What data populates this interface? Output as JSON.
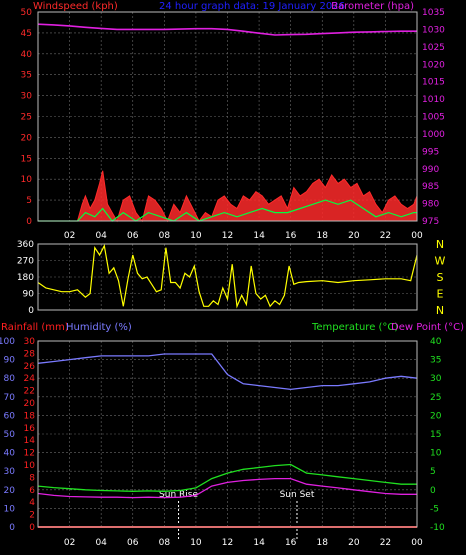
{
  "header": {
    "left_title": "Windspeed (kph)",
    "center_title": "24 hour graph data: 19 January 2026",
    "right_title": "Barometer (hpa)"
  },
  "colors": {
    "background": "#000000",
    "grid": "#6a6a6a",
    "windspeed": "#ff2a2a",
    "gust": "#ff2a2a",
    "wind_avg": "#00ff40",
    "wind_min": "#ffffff",
    "barometer": "#e020e0",
    "direction": "#ffff00",
    "rainfall": "#ff2020",
    "humidity": "#7a7aff",
    "temperature": "#20e020",
    "dewpoint": "#e020e0",
    "title_blue": "#2020ff",
    "sun_marker": "#ffffff"
  },
  "chart_data": [
    {
      "id": "wind_pressure",
      "type": "line",
      "title": "24 hour graph data: 19 January 2026",
      "ylabel_left": "Windspeed (kph)",
      "ylabel_right": "Barometer (hpa)",
      "ylim_left": [
        0,
        50
      ],
      "ylim_right": [
        975,
        1035
      ],
      "yticks_left": [
        0,
        5,
        10,
        15,
        20,
        25,
        30,
        35,
        40,
        45,
        50
      ],
      "yticks_right": [
        975,
        980,
        985,
        990,
        995,
        1000,
        1005,
        1010,
        1015,
        1020,
        1025,
        1030,
        1035
      ],
      "xlim": [
        0,
        24
      ],
      "xtick_labels": [
        "02",
        "04",
        "06",
        "08",
        "10",
        "12",
        "14",
        "16",
        "18",
        "20",
        "22",
        "00"
      ],
      "grid": true,
      "series": [
        {
          "name": "Barometer",
          "axis": "right",
          "x": [
            0,
            1,
            2,
            3,
            4,
            5,
            6,
            7,
            8,
            9,
            10,
            11,
            12,
            13,
            14,
            15,
            16,
            17,
            18,
            19,
            20,
            21,
            22,
            23,
            24
          ],
          "values": [
            1031.5,
            1031.3,
            1031.0,
            1030.6,
            1030.3,
            1030.0,
            1030.0,
            1030.0,
            1030.0,
            1030.1,
            1030.2,
            1030.2,
            1030.0,
            1029.5,
            1028.9,
            1028.4,
            1028.5,
            1028.6,
            1028.8,
            1029.0,
            1029.2,
            1029.3,
            1029.4,
            1029.5,
            1029.5
          ]
        },
        {
          "name": "Gust",
          "axis": "left",
          "x": [
            0,
            1,
            2,
            2.5,
            2.8,
            3,
            3.3,
            3.6,
            3.9,
            4.1,
            4.4,
            4.7,
            5,
            5.4,
            5.8,
            6.2,
            6.6,
            7,
            7.4,
            7.8,
            8.2,
            8.6,
            9,
            9.4,
            9.8,
            10.2,
            10.6,
            11,
            11.4,
            11.8,
            12.2,
            12.6,
            13,
            13.4,
            13.8,
            14.2,
            14.6,
            15,
            15.4,
            15.8,
            16.2,
            16.6,
            17,
            17.4,
            17.8,
            18.2,
            18.6,
            19,
            19.4,
            19.8,
            20.2,
            20.6,
            21,
            21.4,
            21.8,
            22.2,
            22.6,
            23,
            23.4,
            23.8,
            24
          ],
          "values": [
            0,
            0,
            0,
            0,
            4,
            6,
            3,
            5,
            9,
            12,
            4,
            2,
            0,
            5,
            6,
            2,
            0,
            6,
            5,
            3,
            0,
            4,
            2,
            6,
            3,
            0,
            2,
            1,
            5,
            6,
            4,
            3,
            6,
            5,
            7,
            6,
            4,
            5,
            6,
            3,
            8,
            6,
            7,
            9,
            10,
            8,
            11,
            9,
            10,
            8,
            9,
            6,
            7,
            4,
            2,
            5,
            6,
            4,
            3,
            4,
            6
          ]
        },
        {
          "name": "Average",
          "axis": "left",
          "x": [
            0,
            2.5,
            3,
            3.6,
            4.1,
            4.7,
            5.4,
            6.2,
            7,
            7.8,
            8.6,
            9.4,
            10.2,
            11,
            11.8,
            12.6,
            13.4,
            14.2,
            15,
            15.8,
            16.6,
            17.4,
            18.2,
            19,
            19.8,
            20.6,
            21.4,
            22.2,
            23,
            23.8,
            24
          ],
          "values": [
            0,
            0,
            2,
            1,
            3,
            0,
            2,
            0,
            2,
            1,
            0,
            2,
            0,
            1,
            2,
            1,
            2,
            3,
            2,
            2,
            3,
            4,
            5,
            4,
            5,
            3,
            1,
            2,
            1,
            2,
            2
          ]
        }
      ]
    },
    {
      "id": "wind_direction",
      "type": "line",
      "ylim": [
        0,
        360
      ],
      "yticks": [
        0,
        90,
        180,
        270,
        360
      ],
      "compass_labels": [
        "N",
        "W",
        "S",
        "E",
        "N"
      ],
      "xlim": [
        0,
        24
      ],
      "grid": true,
      "series": [
        {
          "name": "Direction",
          "x": [
            0,
            0.5,
            1,
            1.5,
            2,
            2.5,
            3,
            3.3,
            3.6,
            3.9,
            4.2,
            4.5,
            4.8,
            5.1,
            5.4,
            5.7,
            6,
            6.3,
            6.6,
            6.9,
            7.2,
            7.5,
            7.8,
            8.1,
            8.4,
            8.7,
            9,
            9.3,
            9.6,
            9.9,
            10.2,
            10.5,
            10.8,
            11.1,
            11.4,
            11.7,
            12,
            12.3,
            12.6,
            12.9,
            13.2,
            13.5,
            13.8,
            14.1,
            14.4,
            14.7,
            15,
            15.3,
            15.6,
            15.9,
            16.2,
            16.5,
            17,
            18,
            19,
            20,
            21,
            22,
            23,
            23.6,
            24
          ],
          "values": [
            150,
            120,
            110,
            100,
            100,
            110,
            70,
            90,
            340,
            300,
            350,
            200,
            230,
            160,
            20,
            170,
            300,
            200,
            170,
            180,
            140,
            100,
            110,
            340,
            150,
            150,
            120,
            200,
            180,
            240,
            100,
            20,
            20,
            50,
            30,
            120,
            60,
            250,
            20,
            80,
            30,
            240,
            90,
            60,
            80,
            20,
            50,
            30,
            80,
            240,
            140,
            150,
            155,
            160,
            150,
            160,
            165,
            170,
            170,
            160,
            300
          ]
        }
      ]
    },
    {
      "id": "temperature_humidity",
      "type": "line",
      "ylabel_rain": "Rainfall (mm)",
      "ylabel_humidity": "Humidity (%)",
      "ylabel_temp": "Temperature (°C)",
      "ylabel_dew": "Dew Point (°C)",
      "ylim_humidity": [
        0,
        100
      ],
      "ylim_rain": [
        0,
        30
      ],
      "ylim_temp": [
        -10,
        40
      ],
      "yticks_humidity": [
        0,
        10,
        20,
        30,
        40,
        50,
        60,
        70,
        80,
        90,
        100
      ],
      "yticks_rain": [
        0,
        2,
        4,
        6,
        8,
        10,
        12,
        14,
        16,
        18,
        20,
        22,
        24,
        26,
        28,
        30
      ],
      "yticks_temp": [
        -10,
        -5,
        0,
        5,
        10,
        15,
        20,
        25,
        30,
        35,
        40
      ],
      "xlim": [
        0,
        24
      ],
      "xtick_labels": [
        "02",
        "04",
        "06",
        "08",
        "10",
        "12",
        "14",
        "16",
        "18",
        "20",
        "22",
        "00"
      ],
      "grid": true,
      "annotations": [
        {
          "label": "Sun Rise",
          "x": 8.9
        },
        {
          "label": "Sun Set",
          "x": 16.4
        }
      ],
      "series": [
        {
          "name": "Humidity",
          "axis": "humidity",
          "x": [
            0,
            1,
            2,
            3,
            4,
            5,
            6,
            7,
            8,
            9,
            10,
            11,
            12,
            13,
            14,
            15,
            16,
            17,
            18,
            19,
            20,
            21,
            22,
            23,
            24
          ],
          "values": [
            88,
            89,
            90,
            91,
            92,
            92,
            92,
            92,
            93,
            93,
            93,
            93,
            82,
            77,
            76,
            75,
            74,
            75,
            76,
            76,
            77,
            78,
            80,
            81,
            80
          ]
        },
        {
          "name": "Temperature",
          "axis": "temp",
          "x": [
            0,
            1,
            2,
            3,
            4,
            5,
            6,
            7,
            8,
            9,
            10,
            11,
            12,
            13,
            14,
            15,
            16,
            17,
            18,
            19,
            20,
            21,
            22,
            23,
            24
          ],
          "values": [
            1.0,
            0.6,
            0.3,
            0.0,
            -0.2,
            -0.3,
            -0.4,
            -0.3,
            -0.4,
            -0.2,
            0.5,
            3.0,
            4.5,
            5.5,
            6.0,
            6.5,
            6.8,
            4.5,
            4.0,
            3.5,
            3.0,
            2.5,
            2.0,
            1.5,
            1.5
          ]
        },
        {
          "name": "Dew Point",
          "axis": "temp",
          "x": [
            0,
            1,
            2,
            3,
            4,
            5,
            6,
            7,
            8,
            9,
            10,
            11,
            12,
            13,
            14,
            15,
            16,
            17,
            18,
            19,
            20,
            21,
            22,
            23,
            24
          ],
          "values": [
            -1.0,
            -1.5,
            -1.8,
            -1.9,
            -2.0,
            -2.0,
            -2.1,
            -2.0,
            -2.1,
            -2.0,
            -1.5,
            1.0,
            2.0,
            2.5,
            2.8,
            3.0,
            3.0,
            1.5,
            1.0,
            0.5,
            0.0,
            -0.5,
            -1.0,
            -1.2,
            -1.2
          ]
        },
        {
          "name": "Rainfall",
          "axis": "rain",
          "x": [
            0,
            24
          ],
          "values": [
            0,
            0
          ]
        }
      ]
    }
  ]
}
